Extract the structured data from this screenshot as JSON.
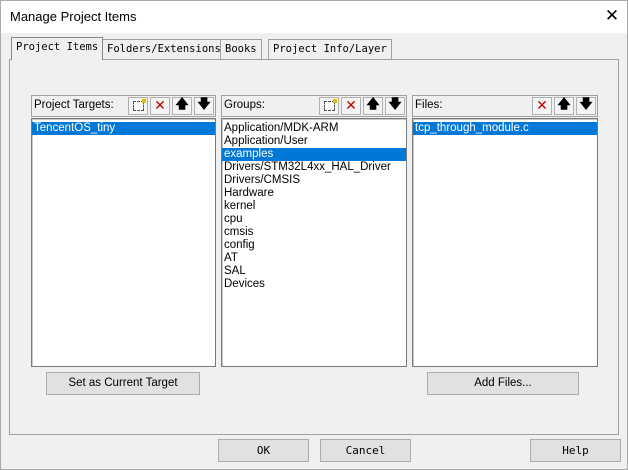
{
  "window": {
    "title": "Manage Project Items",
    "close_symbol": "✕"
  },
  "tabs": [
    {
      "label": "Project Items",
      "active": true
    },
    {
      "label": "Folders/Extensions",
      "active": false
    },
    {
      "label": "Books",
      "active": false
    },
    {
      "label": "Project Info/Layer",
      "active": false
    }
  ],
  "targets": {
    "header": "Project Targets:",
    "items": [
      "TencentOS_tiny"
    ],
    "selected_index": 0,
    "button": "Set as Current Target"
  },
  "groups": {
    "header": "Groups:",
    "items": [
      "Application/MDK-ARM",
      "Application/User",
      "examples",
      "Drivers/STM32L4xx_HAL_Driver",
      "Drivers/CMSIS",
      "Hardware",
      "kernel",
      "cpu",
      "cmsis",
      "config",
      "AT",
      "SAL",
      "Devices"
    ],
    "selected_index": 2
  },
  "files": {
    "header": "Files:",
    "items": [
      "tcp_through_module.c"
    ],
    "selected_index": 0,
    "button": "Add Files..."
  },
  "toolbar_glyphs": {
    "delete": "✕",
    "up": "🡅",
    "down": "🡇"
  },
  "footer": {
    "ok": "OK",
    "cancel": "Cancel",
    "help": "Help"
  },
  "colors": {
    "selection": "#0078d7",
    "delete_icon": "#c00000"
  }
}
